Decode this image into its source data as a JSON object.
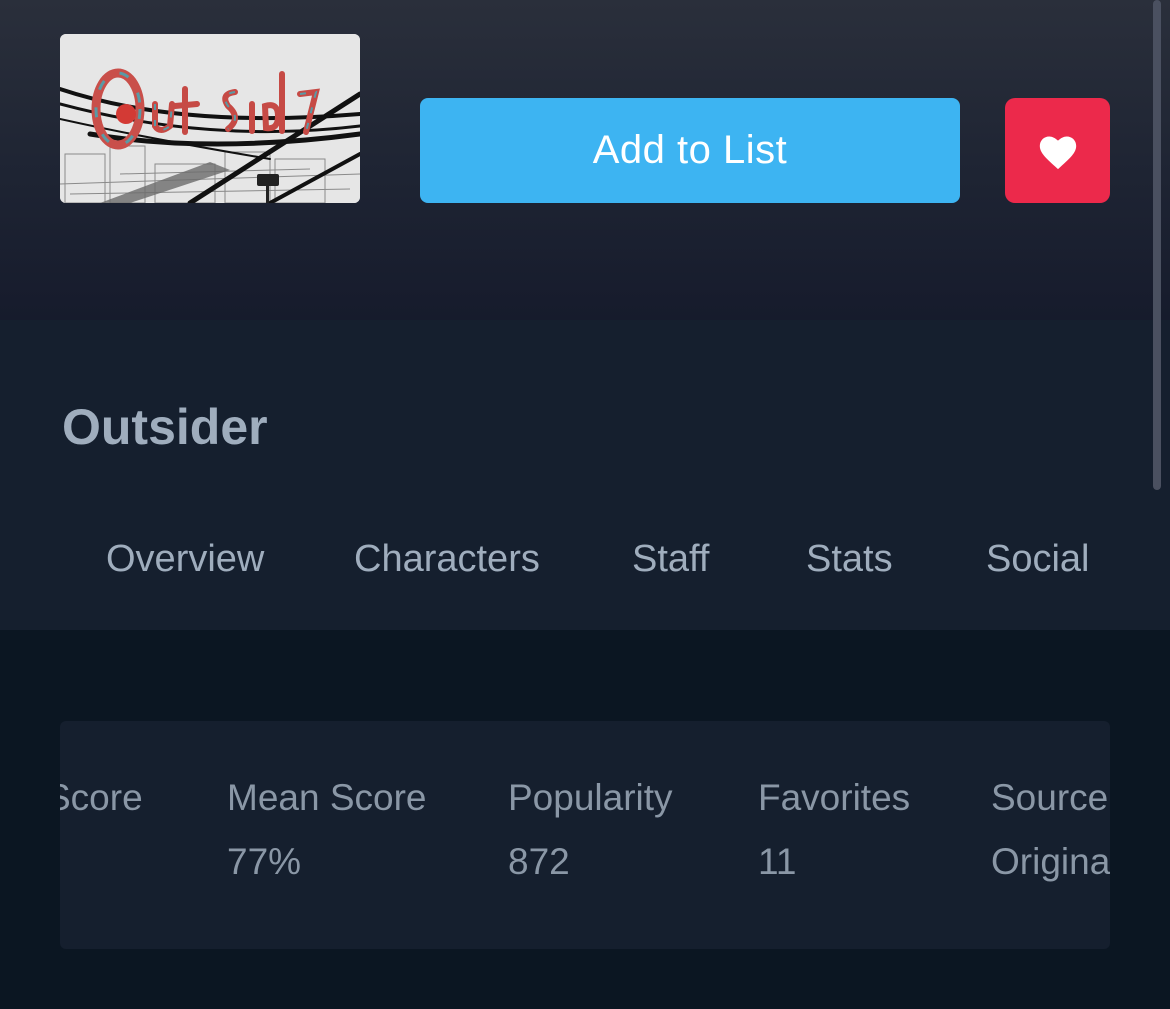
{
  "media": {
    "cover_alt": "Outsider cover",
    "cover_logo_text": "Out Sider",
    "title": "Outsider"
  },
  "actions": {
    "add_to_list_label": "Add to List",
    "favorite_icon": "heart-icon"
  },
  "tabs": [
    {
      "label": "Overview"
    },
    {
      "label": "Characters"
    },
    {
      "label": "Staff"
    },
    {
      "label": "Stats"
    },
    {
      "label": "Social"
    }
  ],
  "stats": [
    {
      "label": "Score",
      "value": ""
    },
    {
      "label": "Mean Score",
      "value": "77%"
    },
    {
      "label": "Popularity",
      "value": "872"
    },
    {
      "label": "Favorites",
      "value": "11"
    },
    {
      "label": "Source",
      "value": "Original"
    }
  ],
  "colors": {
    "accent_blue": "#3db4f2",
    "favorite_red": "#ec294b",
    "text_muted": "#9fadbd",
    "background": "#0b1622",
    "panel": "#151f2e"
  }
}
